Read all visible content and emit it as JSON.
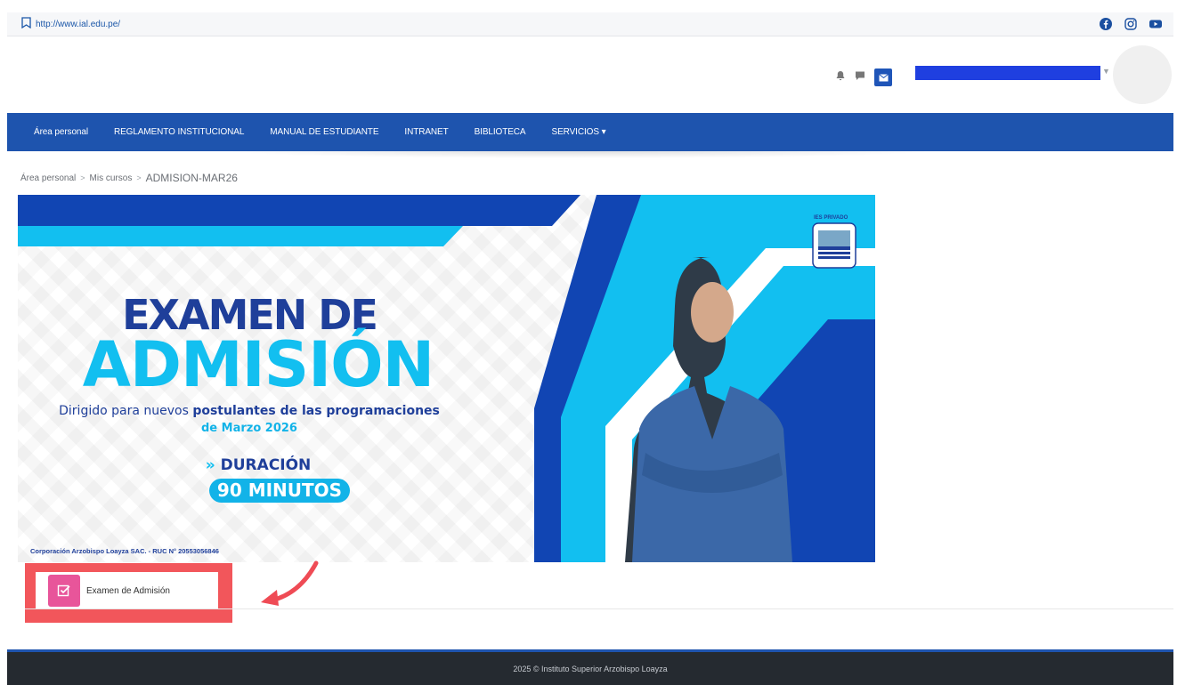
{
  "topbar": {
    "url": "http://www.ial.edu.pe/"
  },
  "nav": {
    "items": [
      "Área personal",
      "REGLAMENTO INSTITUCIONAL",
      "MANUAL DE ESTUDIANTE",
      "INTRANET",
      "BIBLIOTECA"
    ],
    "services_label": "SERVICIOS ▾"
  },
  "breadcrumb": [
    "Área personal",
    "Mis cursos",
    "ADMISION-MAR26"
  ],
  "banner": {
    "title_line1": "EXAMEN DE",
    "title_line2": "ADMISIÓN",
    "subtitle_prefix": "Dirigido para nuevos ",
    "subtitle_bold": "postulantes de las programaciones",
    "date": "de Marzo 2026",
    "duration_label": "DURACIÓN",
    "duration_value": "90 MINUTOS",
    "corp": "Corporación Arzobispo Loayza SAC. - RUC N° 20553056846",
    "logo_text": "IES PRIVADO"
  },
  "activity": {
    "label": "Examen de Admisión"
  },
  "footer": {
    "text": "2025 © Instituto Superior Arzobispo Loayza"
  },
  "colors": {
    "nav": "#1e54ae",
    "highlight_box": "#f2565b",
    "quiz_icon": "#e8559a",
    "banner_cyan": "#12bff0",
    "banner_navy": "#1f3f9a",
    "footer": "#252a30"
  },
  "icons": [
    "bookmark-icon",
    "facebook-icon",
    "instagram-icon",
    "youtube-icon",
    "bell-icon",
    "chat-icon",
    "mail-icon",
    "quiz-icon",
    "arrow-icon"
  ]
}
